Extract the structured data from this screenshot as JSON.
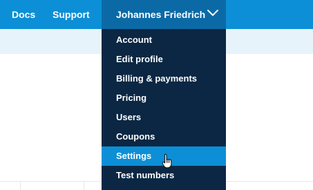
{
  "nav": {
    "docs_label": "Docs",
    "support_label": "Support"
  },
  "user_menu": {
    "name": "Johannes Friedrich",
    "icon": "chevron-down-icon"
  },
  "dropdown": {
    "items": [
      {
        "label": "Account",
        "active": false
      },
      {
        "label": "Edit profile",
        "active": false
      },
      {
        "label": "Billing & payments",
        "active": false
      },
      {
        "label": "Pricing",
        "active": false
      },
      {
        "label": "Users",
        "active": false
      },
      {
        "label": "Coupons",
        "active": false
      },
      {
        "label": "Settings",
        "active": true
      },
      {
        "label": "Test numbers",
        "active": false
      }
    ]
  },
  "colors": {
    "topbar": "#0c8fd6",
    "user_menu": "#0b6aa6",
    "dropdown": "#0b2744",
    "active_item": "#0c8fd6",
    "subbar": "#e6f3fb"
  },
  "cursor": {
    "icon": "hand-pointer-icon"
  }
}
